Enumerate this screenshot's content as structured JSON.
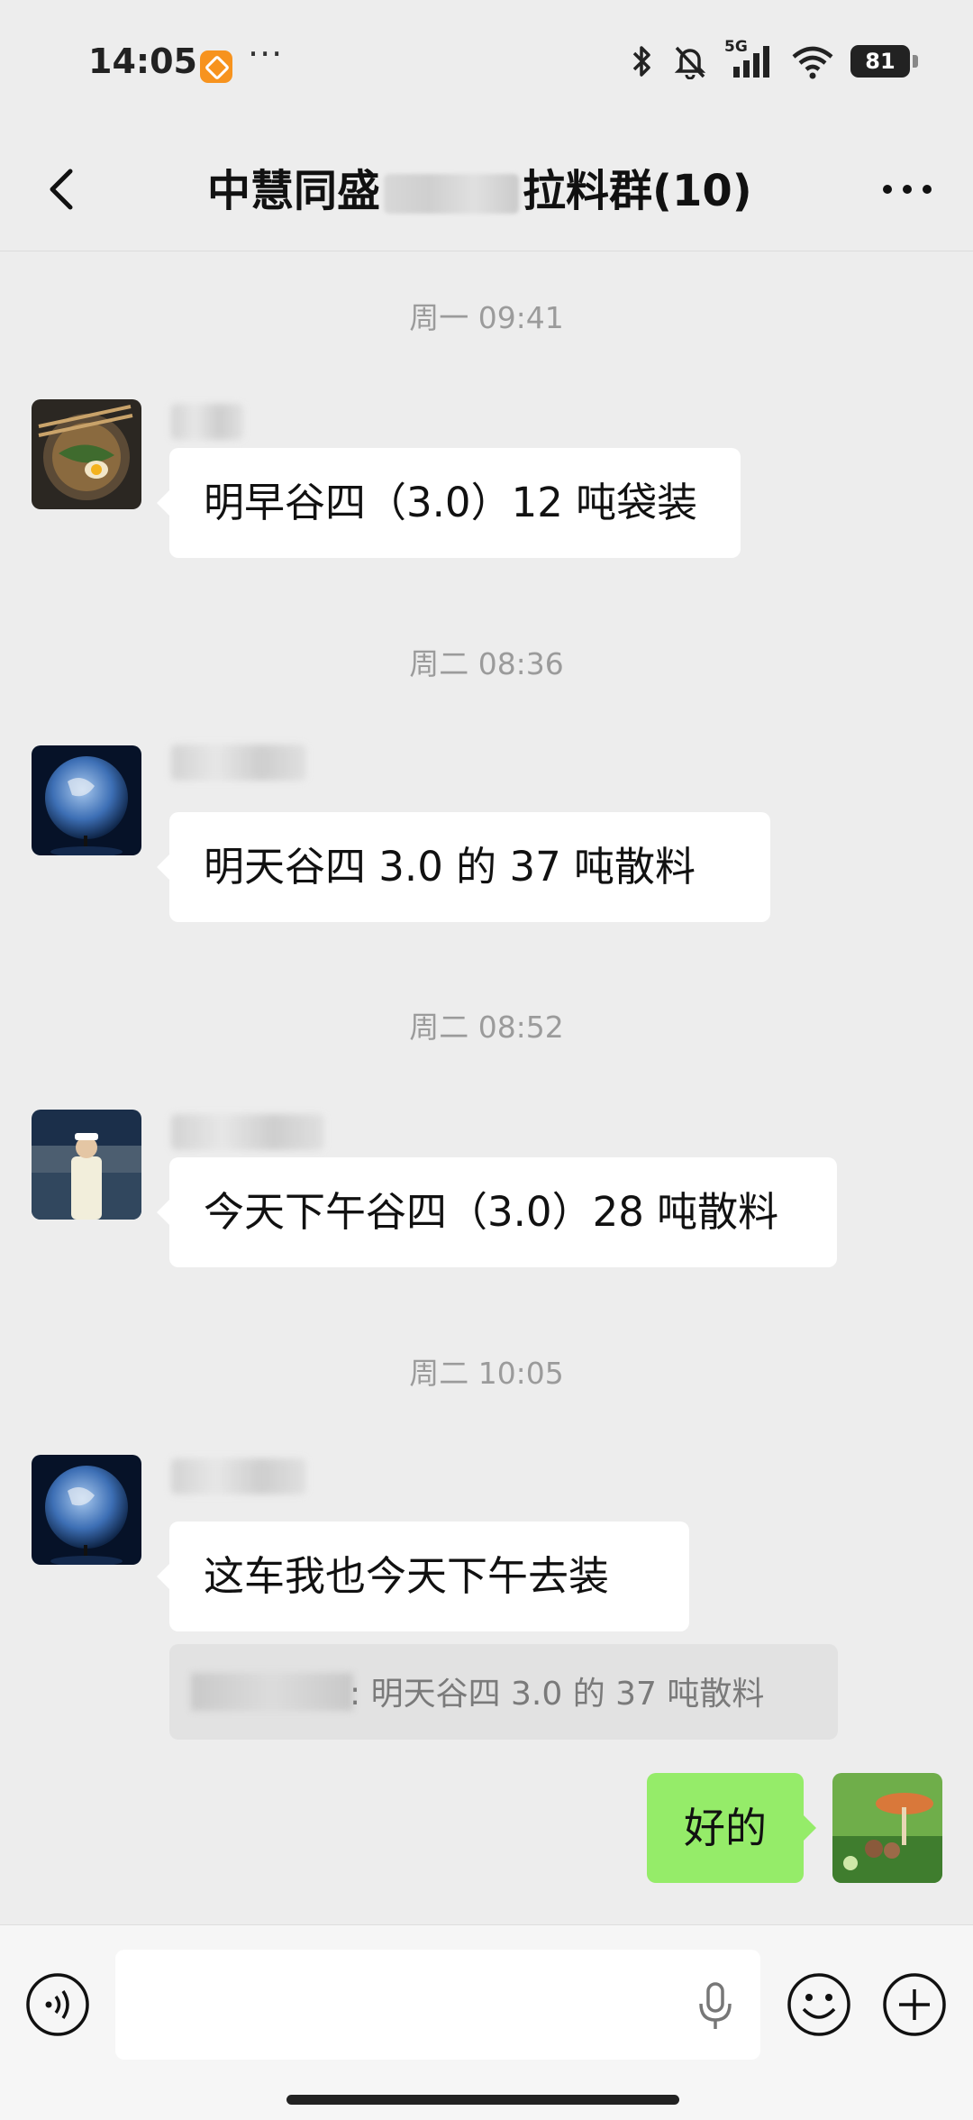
{
  "status_bar": {
    "time": "14:05",
    "overflow": "···",
    "network": "5G",
    "battery": "81"
  },
  "header": {
    "title_prefix": "中慧同盛",
    "title_suffix": "拉料群(10)"
  },
  "messages": [
    {
      "timestamp": "周一 09:41",
      "text": "明早谷四（3.0）12 吨袋装"
    },
    {
      "timestamp": "周二 08:36",
      "text": "明天谷四 3.0 的 37 吨散料"
    },
    {
      "timestamp": "周二 08:52",
      "text": "今天下午谷四（3.0）28 吨散料"
    },
    {
      "timestamp": "周二 10:05",
      "text": "这车我也今天下午去装",
      "quote_text": ": 明天谷四 3.0 的 37 吨散料"
    }
  ],
  "my_message": {
    "text": "好的"
  },
  "colors": {
    "background": "#ededed",
    "my_bubble": "#95ec69",
    "other_bubble": "#ffffff",
    "timestamp": "#9b9b9b"
  },
  "icons": {
    "back": "chevron-left-icon",
    "more": "more-horizontal-icon",
    "voice": "voice-icon",
    "mic": "microphone-icon",
    "emoji": "emoji-icon",
    "plus": "plus-icon"
  }
}
